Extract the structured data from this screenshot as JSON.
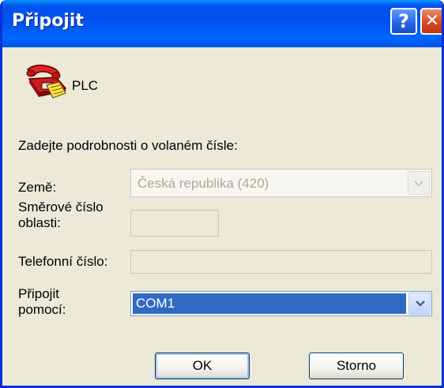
{
  "window": {
    "title": "Připojit",
    "help_label": "?",
    "close_label": "✕"
  },
  "entry": {
    "name": "PLC",
    "icon": "phone-icon"
  },
  "instruction": "Zadejte podrobnosti o volaném čísle:",
  "fields": {
    "country": {
      "label": "Země:",
      "value": "Česká republika (420)",
      "disabled": true
    },
    "area_code": {
      "label_line1": "Směrové číslo",
      "label_line2": "oblasti:",
      "value": "",
      "disabled": true
    },
    "phone": {
      "label": "Telefonní číslo:",
      "value": "",
      "disabled": true
    },
    "connect_using": {
      "label_line1": "Připojit",
      "label_line2": "pomocí:",
      "value": "COM1"
    }
  },
  "buttons": {
    "ok": "OK",
    "cancel": "Storno"
  },
  "colors": {
    "title_bar": "#0055e5",
    "dialog_bg": "#ece9d8",
    "selection": "#316ac5",
    "close_button": "#d9431e"
  }
}
